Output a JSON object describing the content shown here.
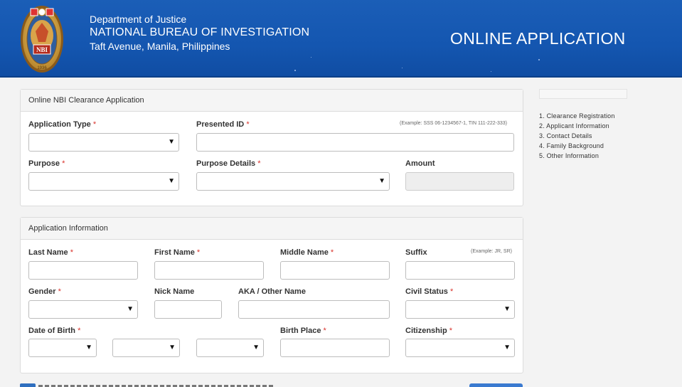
{
  "header": {
    "department": "Department of Justice",
    "bureau": "NATIONAL BUREAU OF INVESTIGATION",
    "address": "Taft Avenue, Manila, Philippines",
    "page_title": "ONLINE APPLICATION",
    "seal_text": "NBI",
    "seal_year": "1936"
  },
  "clearance_panel": {
    "title": "Online NBI Clearance Application",
    "application_type_label": "Application Type",
    "presented_id_label": "Presented ID",
    "presented_id_hint": "(Example: SSS 06-1234567-1, TIN 111-222-333)",
    "purpose_label": "Purpose",
    "purpose_details_label": "Purpose Details",
    "amount_label": "Amount"
  },
  "applicant_panel": {
    "title": "Application Information",
    "last_name_label": "Last Name",
    "first_name_label": "First Name",
    "middle_name_label": "Middle Name",
    "suffix_label": "Suffix",
    "suffix_hint": "(Example: JR, SR)",
    "gender_label": "Gender",
    "nick_name_label": "Nick Name",
    "aka_label": "AKA / Other Name",
    "civil_status_label": "Civil Status",
    "dob_label": "Date of Birth",
    "birth_place_label": "Birth Place",
    "citizenship_label": "Citizenship"
  },
  "required_mark": "*",
  "caret": "▼",
  "steps": [
    "1. Clearance Registration",
    "2. Applicant Information",
    "3. Contact Details",
    "4. Family Background",
    "5. Other Information"
  ],
  "colors": {
    "header_blue": "#1456b0",
    "required_red": "#d9322b"
  }
}
